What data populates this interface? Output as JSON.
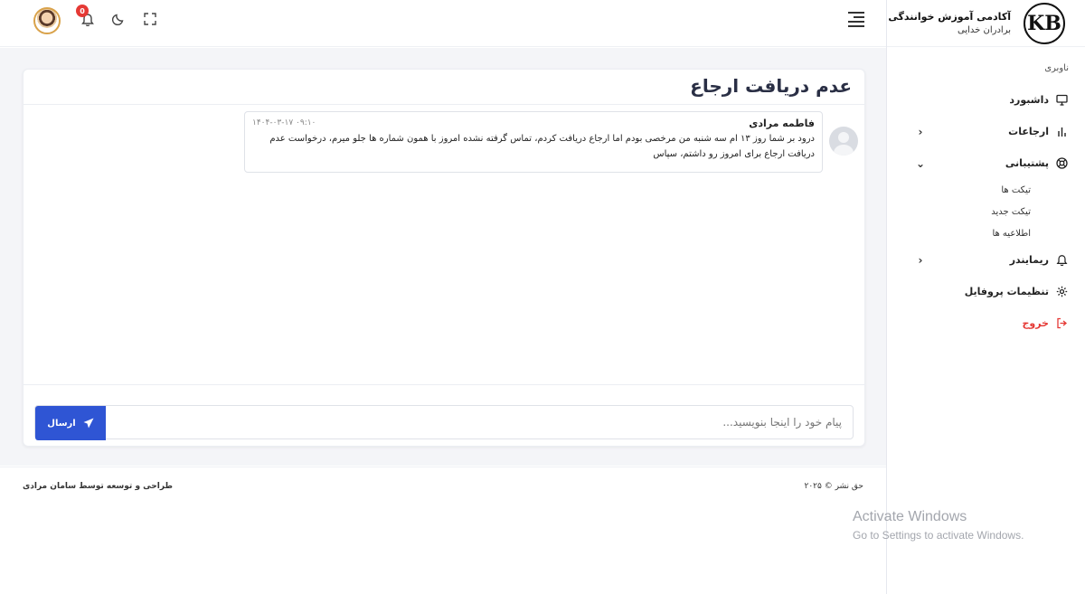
{
  "brand": {
    "title": "آکادمی آموزش خوانندگی",
    "subtitle": "برادران خدایی",
    "logo_text": "KB"
  },
  "sidebar": {
    "section_label": "ناوبری",
    "items": [
      {
        "label": "داشبورد",
        "icon": "monitor-icon",
        "expandable": false
      },
      {
        "label": "ارجاعات",
        "icon": "bar-chart-icon",
        "expandable": true
      },
      {
        "label": "پشتیبانی",
        "icon": "lifebuoy-icon",
        "expandable": true,
        "expanded": true
      },
      {
        "label": "ریمایندر",
        "icon": "bell-icon",
        "expandable": true
      },
      {
        "label": "تنظیمات پروفایل",
        "icon": "gear-icon",
        "expandable": false
      },
      {
        "label": "خروج",
        "icon": "logout-icon",
        "expandable": false
      }
    ],
    "support_sub": [
      "تیکت ها",
      "تیکت جدید",
      "اطلاعیه ها"
    ]
  },
  "header": {
    "notification_count": "0",
    "icons": [
      "menu-icon",
      "fullscreen-icon",
      "moon-icon",
      "bell-icon",
      "avatar"
    ]
  },
  "ticket": {
    "title": "عدم دریافت ارجاع",
    "messages": [
      {
        "author": "فاطمه مرادی",
        "time": "۱۴۰۴-۰۳-۱۷ ۰۹:۱۰",
        "text": "درود بر شما روز ۱۳ ام سه شنبه من مرخصی بودم اما ارجاع دریافت کردم، تماس گرفته نشده امروز با همون شماره ها جلو میرم، درخواست عدم دریافت ارجاع برای امروز رو داشتم، سپاس"
      }
    ],
    "composer": {
      "placeholder": "پیام خود را اینجا بنویسید...",
      "value": "",
      "send_label": "ارسال"
    }
  },
  "footer": {
    "credits": "طراحی و توسعه توسط سامان مرادی",
    "copyright": "حق نشر © ۲۰۲۵"
  },
  "watermark": {
    "title": "Activate Windows",
    "subtitle": "Go to Settings to activate Windows."
  },
  "colors": {
    "accent": "#2f55d4",
    "danger": "#e53935",
    "background": "#f4f5f8"
  }
}
